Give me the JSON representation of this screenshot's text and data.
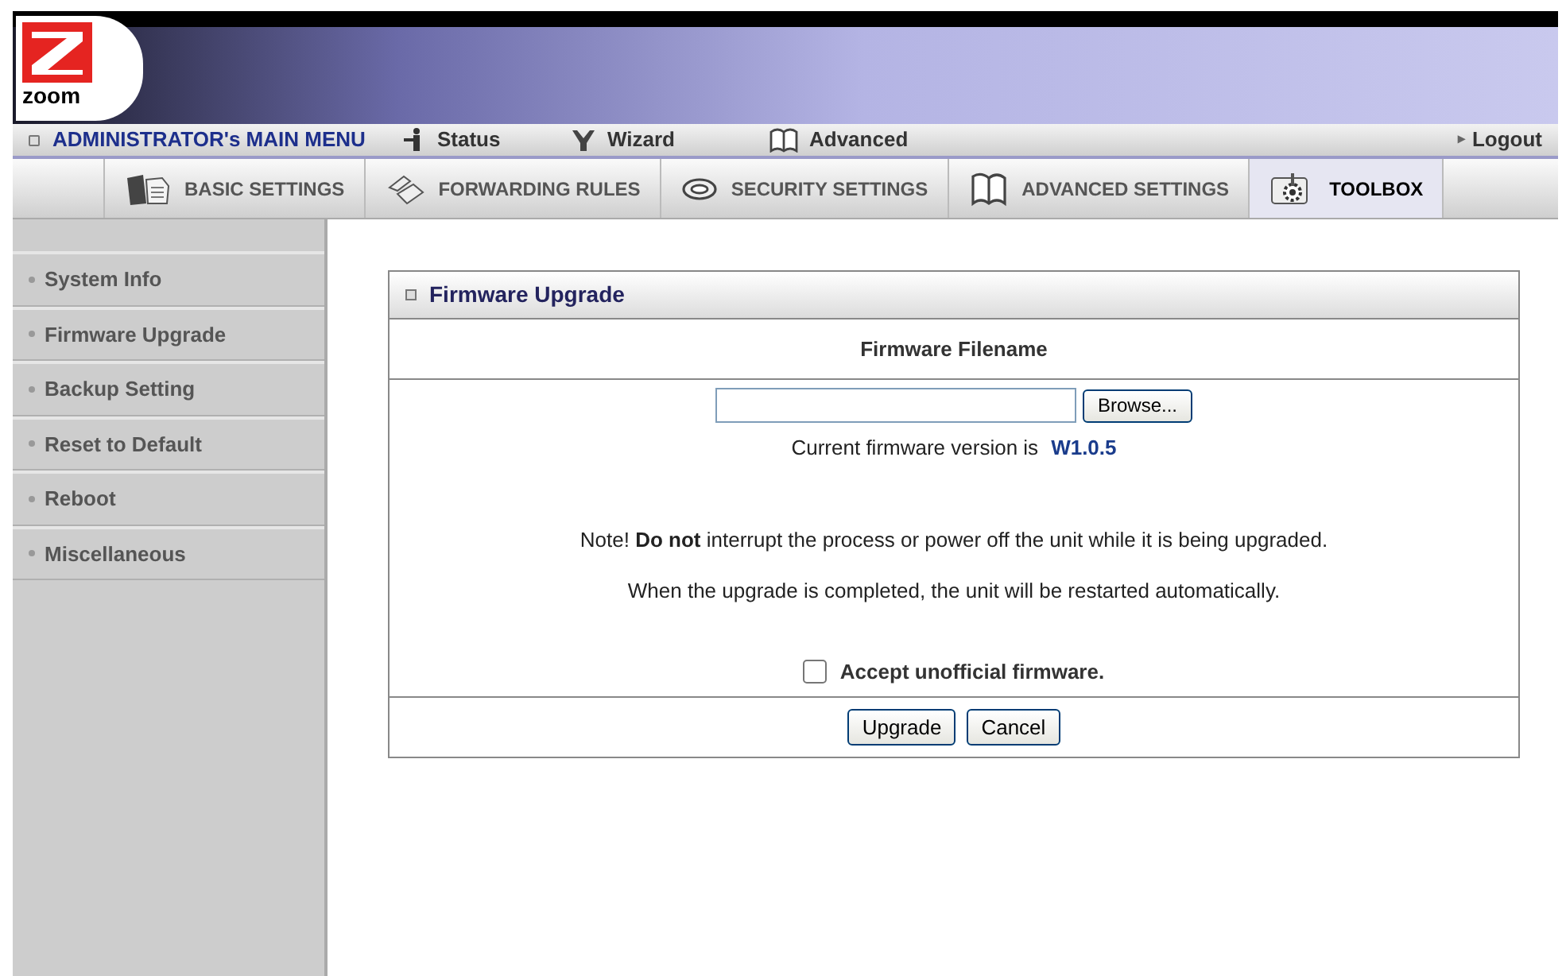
{
  "brand": {
    "logo_text": "zoom"
  },
  "main_menu": {
    "title": "ADMINISTRATOR's MAIN MENU",
    "links": [
      {
        "label": "Status"
      },
      {
        "label": "Wizard"
      },
      {
        "label": "Advanced"
      }
    ],
    "logout": "Logout",
    "logout_marker": "▸"
  },
  "tabs": [
    {
      "label": "BASIC SETTINGS",
      "selected": false
    },
    {
      "label": "FORWARDING RULES",
      "selected": false
    },
    {
      "label": "SECURITY SETTINGS",
      "selected": false
    },
    {
      "label": "ADVANCED SETTINGS",
      "selected": false
    },
    {
      "label": "TOOLBOX",
      "selected": true
    }
  ],
  "sidebar": {
    "items": [
      {
        "label": "System Info"
      },
      {
        "label": "Firmware Upgrade"
      },
      {
        "label": "Backup Setting"
      },
      {
        "label": "Reset to Default"
      },
      {
        "label": "Reboot"
      },
      {
        "label": "Miscellaneous"
      }
    ]
  },
  "panel": {
    "title": "Firmware Upgrade",
    "section_heading": "Firmware Filename",
    "browse_button": "Browse...",
    "version_label": "Current firmware version is",
    "version_value": "W1.0.5",
    "notes": [
      "Note! **Do not** interrupt the process or power off the unit while it is being upgraded.",
      "When the upgrade is completed, the unit will be restarted automatically."
    ],
    "accept_checkbox": {
      "label": "Accept unofficial firmware.",
      "checked": false
    },
    "buttons": [
      "Upgrade",
      "Cancel"
    ]
  }
}
